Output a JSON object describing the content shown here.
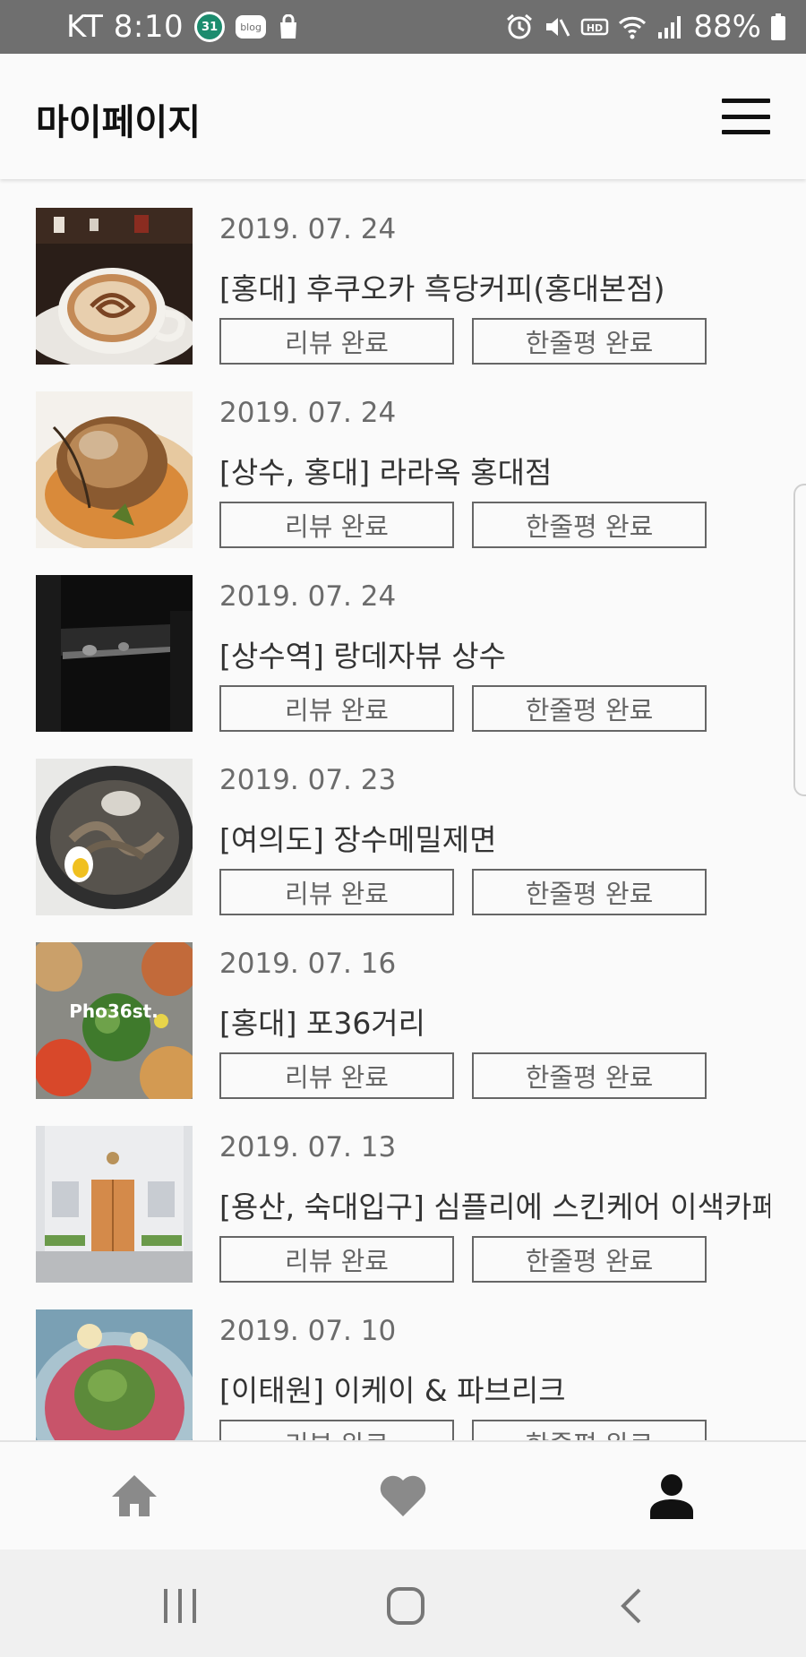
{
  "status_bar": {
    "carrier_time": "KT 8:10",
    "badge": "31",
    "blog": "blog",
    "battery": "88%"
  },
  "header": {
    "title": "마이페이지"
  },
  "items": [
    {
      "date": "2019. 07. 24",
      "name": "[홍대] 후쿠오카 흑당커피(홍대본점)",
      "review": "리뷰 완료",
      "oneline": "한줄평 완료"
    },
    {
      "date": "2019. 07. 24",
      "name": "[상수, 홍대] 라라옥 홍대점",
      "review": "리뷰 완료",
      "oneline": "한줄평 완료"
    },
    {
      "date": "2019. 07. 24",
      "name": "[상수역] 랑데자뷰 상수",
      "review": "리뷰 완료",
      "oneline": "한줄평 완료"
    },
    {
      "date": "2019. 07. 23",
      "name": "[여의도] 장수메밀제면",
      "review": "리뷰 완료",
      "oneline": "한줄평 완료"
    },
    {
      "date": "2019. 07. 16",
      "name": "[홍대] 포36거리",
      "review": "리뷰 완료",
      "oneline": "한줄평 완료",
      "thumb_text": "Pho36st."
    },
    {
      "date": "2019. 07. 13",
      "name": "[용산, 숙대입구] 심플리에 스킨케어 이색카페",
      "review": "리뷰 완료",
      "oneline": "한줄평 완료"
    },
    {
      "date": "2019. 07. 10",
      "name": "[이태원] 이케이 & 파브리크",
      "review": "리뷰 완료",
      "oneline": "한줄평 완료"
    }
  ],
  "bottom_nav": {
    "icons": [
      "home-icon",
      "heart-icon",
      "person-icon"
    ],
    "active": "person-icon"
  },
  "colors": {
    "status_bar": "#6f6f6f",
    "background": "#fafafa",
    "button_border": "#666666",
    "date_text": "#6b6b6b"
  }
}
